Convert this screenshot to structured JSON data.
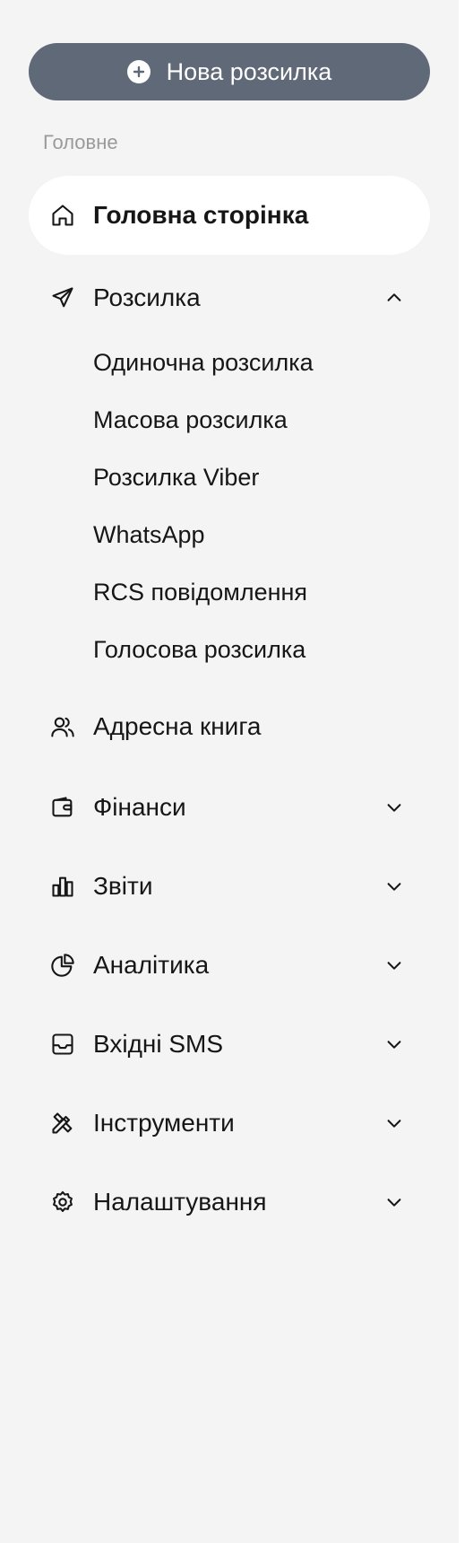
{
  "new_button": {
    "label": "Нова розсилка",
    "icon": "plus-circle-icon"
  },
  "section_label": "Головне",
  "nav": {
    "home": {
      "label": "Головна сторінка",
      "icon": "home-icon"
    },
    "mailing": {
      "label": "Розсилка",
      "icon": "send-icon",
      "expanded": true,
      "children": [
        "Одиночна розсилка",
        "Масова розсилка",
        "Розсилка Viber",
        "WhatsApp",
        "RCS повідомлення",
        "Голосова розсилка"
      ]
    },
    "address_book": {
      "label": "Адресна книга",
      "icon": "users-icon"
    },
    "finance": {
      "label": "Фінанси",
      "icon": "wallet-icon"
    },
    "reports": {
      "label": "Звіти",
      "icon": "bar-chart-icon"
    },
    "analytics": {
      "label": "Аналітика",
      "icon": "pie-chart-icon"
    },
    "inbox_sms": {
      "label": "Вхідні SMS",
      "icon": "inbox-icon"
    },
    "tools": {
      "label": "Інструменти",
      "icon": "tools-icon"
    },
    "settings": {
      "label": "Налаштування",
      "icon": "gear-icon"
    }
  },
  "colors": {
    "sidebar_bg": "#f4f4f4",
    "button_bg": "#5f6977",
    "active_bg": "#ffffff",
    "section_label": "#9a9a9a"
  }
}
